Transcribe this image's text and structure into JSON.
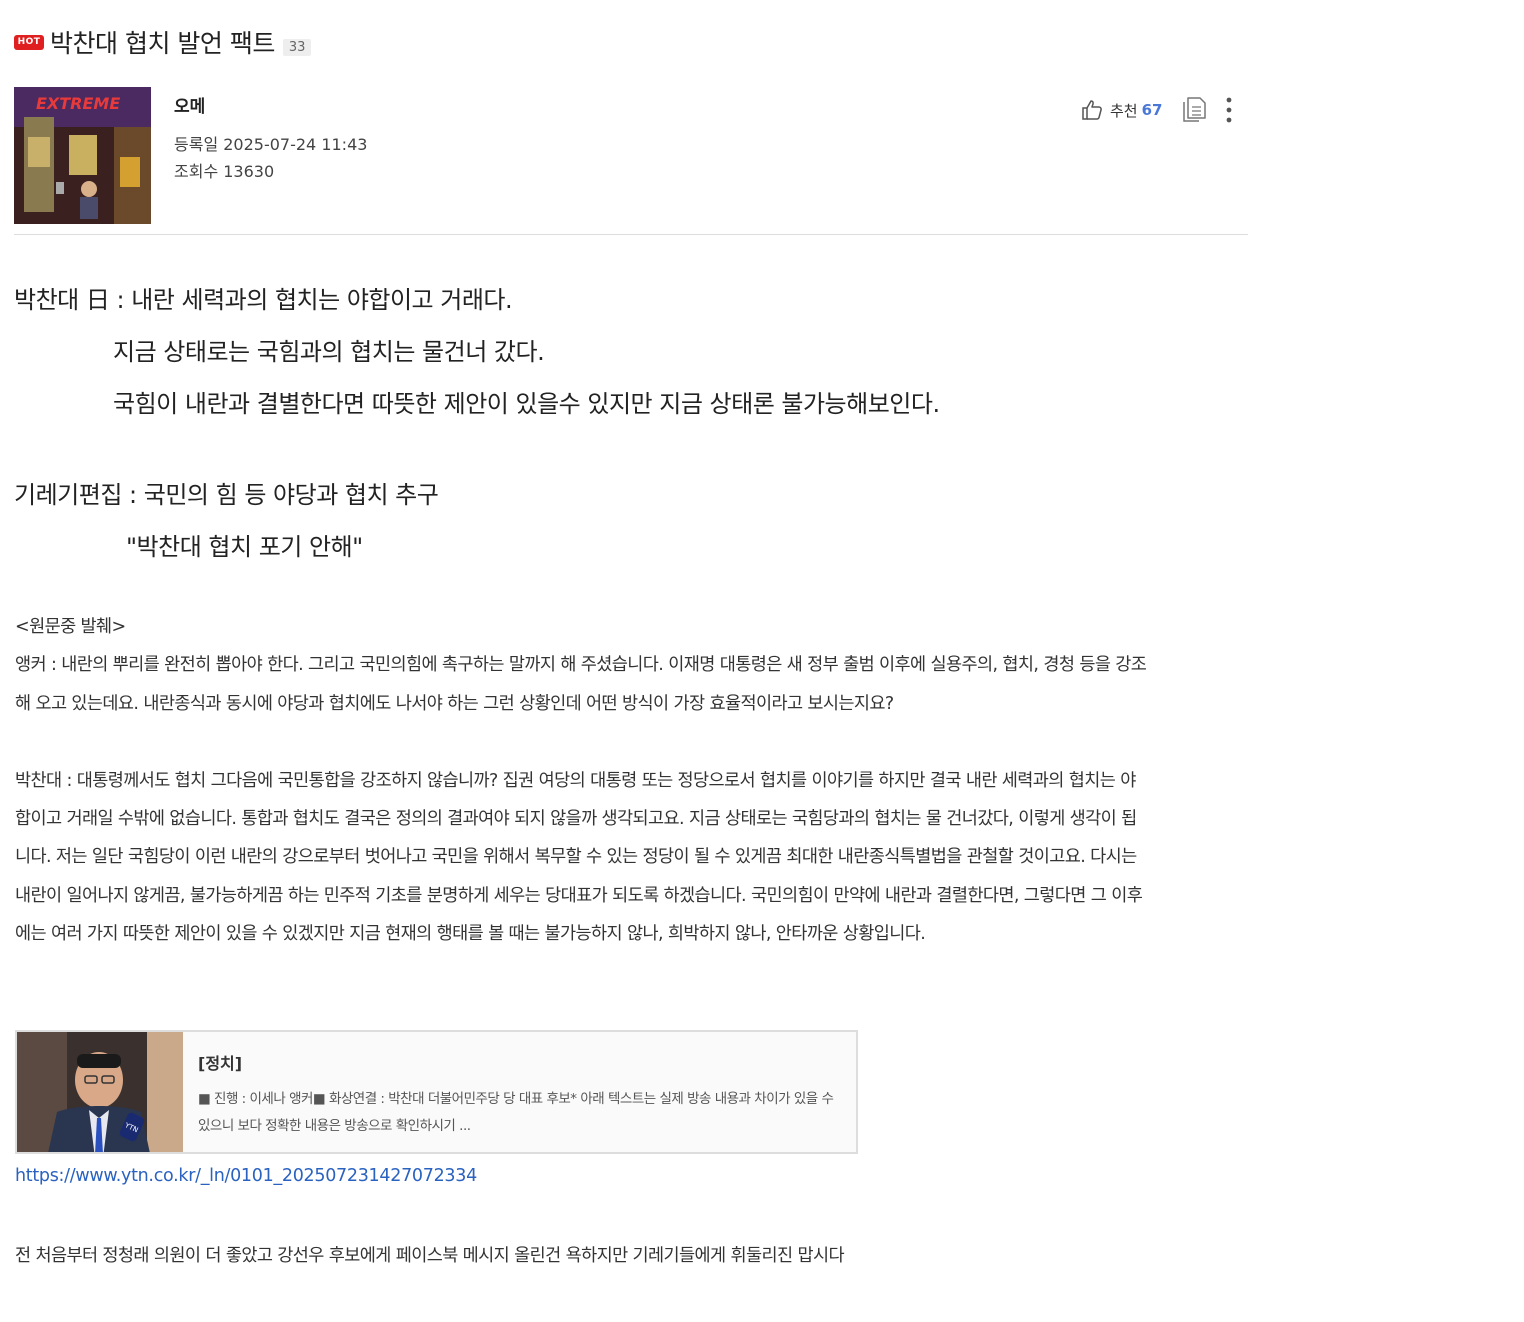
{
  "post": {
    "hot_badge": "HOT",
    "title": "박찬대 협치 발언 팩트",
    "comment_count": "33",
    "author": "오메",
    "date": "등록일 2025-07-24 11:43",
    "views": "조회수 13630",
    "recommend_label": "추천",
    "recommend_count": "67"
  },
  "icons": {
    "recommend": "thumbs-up-icon",
    "copy": "copy-icon",
    "more": "more-vertical-icon"
  },
  "body": {
    "quote_lines": [
      "박찬대 日 : 내란 세력과의 협치는 야합이고 거래다.",
      "지금 상태로는 국힘과의 협치는 물건너 갔다.",
      "국힘이 내란과 결별한다면 따뜻한 제안이 있을수 있지만 지금 상태론 불가능해보인다."
    ],
    "headline_lines": [
      "기레기편집 : 국민의 힘 등 야당과 협치 추구",
      "\"박찬대 협치 포기 안해\""
    ],
    "excerpt_heading": "<원문중 발췌>",
    "anchor_lines": [
      "앵커 : 내란의 뿌리를 완전히 뽑아야 한다. 그리고 국민의힘에 촉구하는 말까지 해 주셨습니다. 이재명 대통령은 새 정부 출범 이후에 실용주의, 협치, 경청 등을 강조",
      "해 오고 있는데요. 내란종식과 동시에 야당과 협치에도 나서야 하는 그런 상황인데 어떤 방식이 가장 효율적이라고 보시는지요?"
    ],
    "answer_lines": [
      "박찬대 : 대통령께서도 협치 그다음에 국민통합을 강조하지 않습니까? 집권 여당의 대통령 또는 정당으로서 협치를 이야기를 하지만 결국 내란 세력과의 협치는 야",
      "합이고 거래일 수밖에 없습니다. 통합과 협치도 결국은 정의의 결과여야 되지 않을까 생각되고요. 지금 상태로는 국힘당과의 협치는 물 건너갔다, 이렇게 생각이 됩",
      "니다. 저는 일단 국힘당이 이런 내란의 강으로부터 벗어나고 국민을 위해서 복무할 수 있는 정당이 될 수 있게끔 최대한 내란종식특별법을 관철할 것이고요. 다시는",
      "내란이 일어나지 않게끔, 불가능하게끔 하는 민주적 기초를 분명하게 세우는 당대표가 되도록 하겠습니다. 국민의힘이 만약에 내란과 결렬한다면, 그렇다면 그 이후",
      "에는 여러 가지 따뜻한 제안이 있을 수 있겠지만 지금 현재의 행태를 볼 때는 불가능하지 않나, 희박하지 않나, 안타까운 상황입니다."
    ],
    "closing": "전 처음부터 정청래 의원이 더 좋았고 강선우 후보에게 페이스북 메시지 올린건 욕하지만 기레기들에게 휘둘리진 맙시다"
  },
  "link_card": {
    "category": "[정치]",
    "description": "■ 진행 : 이세나 앵커■ 화상연결 : 박찬대 더불어민주당 당 대표 후보* 아래 텍스트는 실제 방송 내용과 차이가 있을 수 있으니 보다 정확한 내용은 방송으로 확인하시기 ...",
    "url": "https://www.ytn.co.kr/_ln/0101_202507231427072334"
  },
  "colors": {
    "hot": "#e02020",
    "recommend_count": "#4a78d6",
    "link": "#2a62c0",
    "divider": "#dddddd"
  }
}
